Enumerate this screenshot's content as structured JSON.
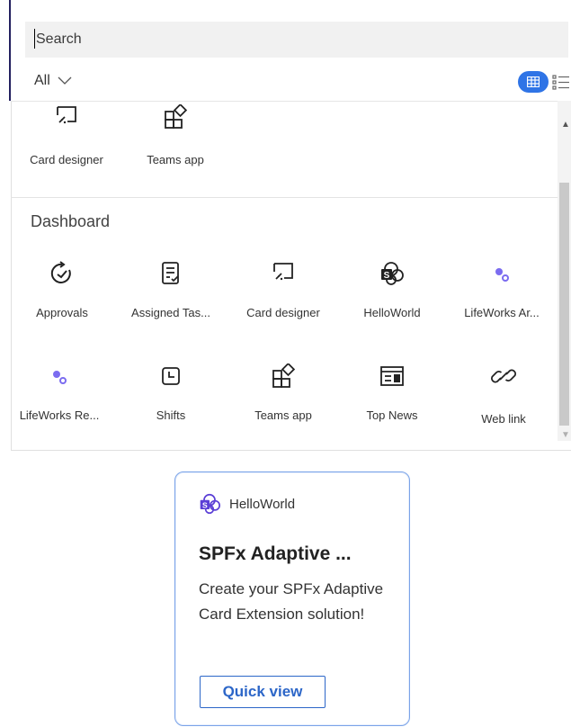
{
  "search": {
    "placeholder": "Search"
  },
  "filter": {
    "label": "All"
  },
  "view_toggle": {
    "grid": "grid-view-icon",
    "list": "list-view-icon"
  },
  "top_row": [
    {
      "label": "Card designer",
      "icon": "card-designer-icon"
    },
    {
      "label": "Teams app",
      "icon": "teams-app-icon"
    }
  ],
  "section": {
    "title": "Dashboard"
  },
  "dashboard_row1": [
    {
      "label": "Approvals",
      "icon": "approvals-icon"
    },
    {
      "label": "Assigned Tas...",
      "icon": "assigned-tasks-icon"
    },
    {
      "label": "Card designer",
      "icon": "card-designer-icon"
    },
    {
      "label": "HelloWorld",
      "icon": "sharepoint-icon"
    },
    {
      "label": "LifeWorks Ar...",
      "icon": "lifeworks-icon"
    }
  ],
  "dashboard_row2": [
    {
      "label": "LifeWorks Re...",
      "icon": "lifeworks-icon"
    },
    {
      "label": "Shifts",
      "icon": "shifts-icon"
    },
    {
      "label": "Teams app",
      "icon": "teams-app-icon"
    },
    {
      "label": "Top News",
      "icon": "top-news-icon"
    },
    {
      "label": "Web link",
      "icon": "web-link-icon"
    }
  ],
  "card": {
    "app": "HelloWorld",
    "title": "SPFx Adaptive ...",
    "description": "Create your SPFx Adaptive Card Extension solution!",
    "button": "Quick view"
  },
  "colors": {
    "accent": "#2f74e6",
    "purple": "#7b6cf0",
    "card_border": "#7aa3e8",
    "brand_dark": "#23205f"
  }
}
